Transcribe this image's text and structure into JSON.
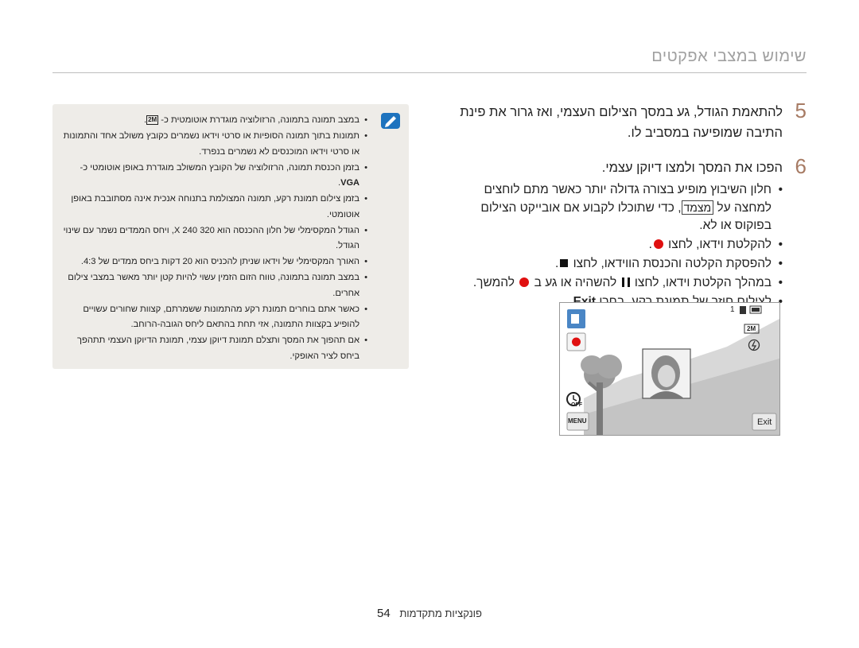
{
  "header": {
    "title": "שימוש במצבי אפקטים"
  },
  "steps": [
    {
      "number": "5",
      "text": "להתאמת הגודל, גע במסך הצילום העצמי, ואז גרור את פינת התיבה שמופיעה במסביב לו."
    },
    {
      "number": "6",
      "text": "הפכו את המסך ולמצו דיוקן עצמי.",
      "bullets": [
        {
          "pre": "חלון השיבוץ מופיע בצורה גדולה יותר כאשר מתם לוחצים למחצה על ",
          "menu": "מצמד",
          "post": ", כדי שתוכלו לקבוע אם אובייקט הצילום בפוקוס או לא."
        },
        {
          "pre": "להקלטת וידאו, לחצו ",
          "post": "."
        },
        {
          "pre": "להפסקת הקלטה והכנסת הווידאו, לחצו ",
          "post": "."
        },
        {
          "pre": "במהלך הקלטת וידאו, לחצו ",
          "mid": " להשהיה או גע ב ",
          "post": " להמשך."
        },
        {
          "pre": "לצילום חוזר של תמונת רקע, בחרו ",
          "bold": "Exit",
          "post": "."
        }
      ]
    }
  ],
  "camera": {
    "counter": "1",
    "exit_label": "Exit",
    "menu_label": "MENU",
    "off_label": "OFF",
    "resolution_label": "2M"
  },
  "note": {
    "items": [
      {
        "pre": "במצב תמונה בתמונה, הרזולוציה מוגדרת אוטומטית כ- ",
        "icon": "2M",
        "post": "."
      },
      {
        "text": "תמונות בתוך תמונה הסופיות או סרטי וידאו נשמרים כקובץ משולב אחד והתמונות או סרטי וידאו המוכנסים לא נשמרים בנפרד."
      },
      {
        "text": "בזמן הכנסת תמונה, הרזולוציה של הקובץ המשולב מוגדרת באופן אוטומטי כ- ",
        "vga": "VGA",
        "post": "."
      },
      {
        "text": "בזמן צילום תמונת רקע, תמונה המצולמת בתנוחה אנכית אינה מסתובבת באופן אוטומטי."
      },
      {
        "text": "הגודל המקסימלי של חלון ההכנסה הוא 320 X 240, ויחס הממדים נשמר עם שינוי הגודל."
      },
      {
        "text": "האורך המקסימלי של וידאו שניתן להכניס הוא 20 דקות ביחס ממדים של 4:3."
      },
      {
        "text": "במצב תמונה בתמונה, טווח הזום הזמין עשוי להיות קטן יותר מאשר במצבי צילום אחרים."
      },
      {
        "text": "כאשר אתם בוחרים תמונת רקע מהתמונות ששמרתם, קצוות שחורים עשויים להופיע בקצוות התמונה, אזי תחת בהתאם ליחס הגובה-הרוחב."
      },
      {
        "text": "אם תהפוך את המסך ותצלם תמונת דיוקן עצמי, תמונת הדיוקן העצמי תתהפך ביחס לציר האופקי."
      }
    ]
  },
  "footer": {
    "section": "פונקציות מתקדמות",
    "page": "54"
  },
  "colors": {
    "step_number": "#a77b64",
    "note_bg": "#eeece8",
    "record_red": "#e01010",
    "note_icon_blue": "#1e73be"
  }
}
